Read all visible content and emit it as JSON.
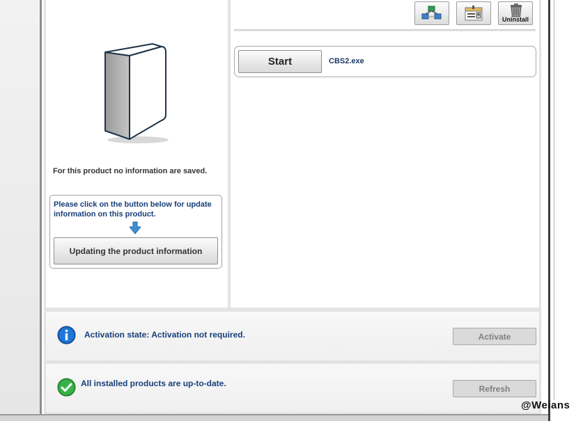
{
  "toolbar": {
    "icons": [
      "network-icon",
      "info-card-icon",
      "trash-icon"
    ],
    "uninstall_label": "Uninstall"
  },
  "programs": [
    {
      "start_label": "Start",
      "exe_name": "CBS2.exe"
    }
  ],
  "product_info": {
    "no_info_text": "For this product no information are saved.",
    "update_instruction": "Please click on the button below for update information on this product.",
    "update_button_label": "Updating the product information"
  },
  "activation": {
    "status_text": "Activation state: Activation not required.",
    "activate_label": "Activate"
  },
  "update_status": {
    "status_text": "All installed products are up-to-date.",
    "refresh_label": "Refresh"
  },
  "watermark": "@Weians",
  "colors": {
    "accent_text": "#173f7a",
    "info_blue": "#1565c0",
    "success_green": "#2e9e3c",
    "arrow_blue": "#3a8fd8"
  }
}
